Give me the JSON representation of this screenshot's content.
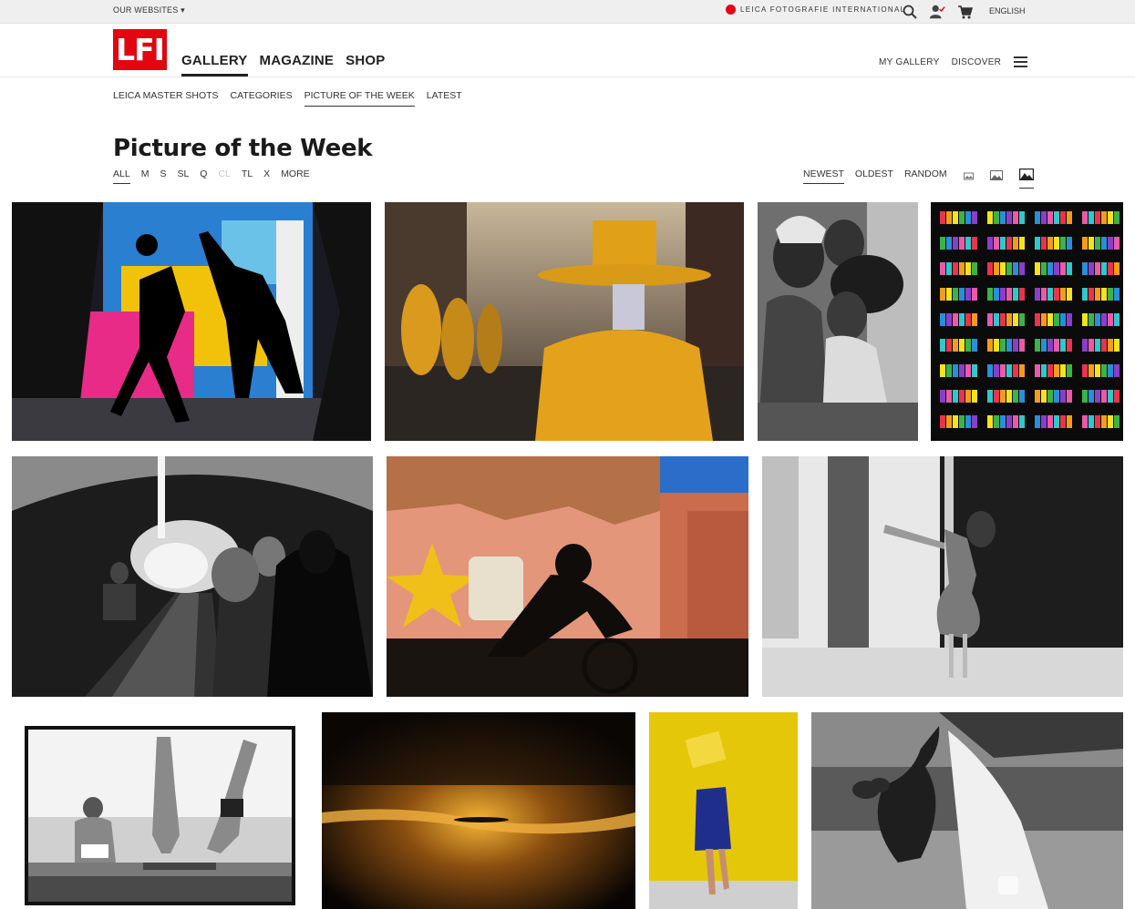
{
  "topbar": {
    "websites_label": "OUR WEBSITES ▾",
    "leica_label": "LEICA FOTOGRAFIE INTERNATIONAL",
    "language": "ENGLISH"
  },
  "header": {
    "logo_text": "LFI",
    "main_nav": [
      "GALLERY",
      "MAGAZINE",
      "SHOP"
    ],
    "right_nav": [
      "MY GALLERY",
      "DISCOVER"
    ]
  },
  "subnav": [
    "LEICA MASTER SHOTS",
    "CATEGORIES",
    "PICTURE OF THE WEEK",
    "LATEST"
  ],
  "page": {
    "title": "Picture of the Week",
    "filters": [
      "ALL",
      "M",
      "S",
      "SL",
      "Q",
      "CL",
      "TL",
      "X",
      "MORE"
    ],
    "sorts": [
      "NEWEST",
      "OLDEST",
      "RANDOM"
    ]
  },
  "colors": {
    "brand_red": "#e20613",
    "text": "#222222",
    "topbar_bg": "#efefef"
  },
  "icons": [
    "search-icon",
    "user-icon",
    "cart-icon",
    "hamburger-icon",
    "view-small-icon",
    "view-medium-icon",
    "view-large-icon"
  ]
}
